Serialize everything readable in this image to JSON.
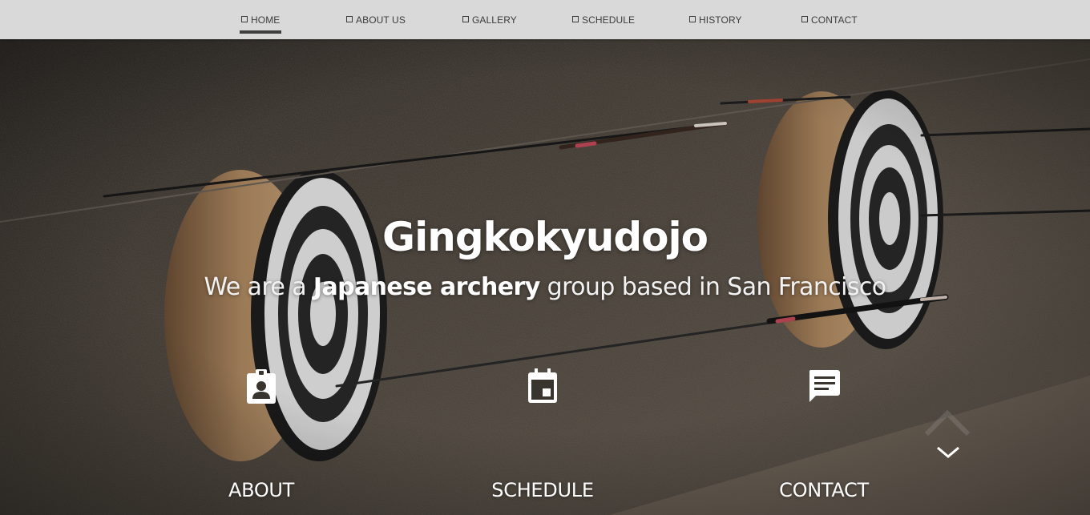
{
  "nav": {
    "items": [
      {
        "label": "HOME",
        "active": true
      },
      {
        "label": "ABOUT US",
        "active": false
      },
      {
        "label": "GALLERY",
        "active": false
      },
      {
        "label": "SCHEDULE",
        "active": false
      },
      {
        "label": "HISTORY",
        "active": false
      },
      {
        "label": "CONTACT",
        "active": false
      }
    ]
  },
  "hero": {
    "title": "Gingkokyudojo",
    "tagline_pre": "We are a ",
    "tagline_bold": "Japanese archery",
    "tagline_post": " group based in San Francisco"
  },
  "features": [
    {
      "label": "ABOUT",
      "icon": "contact-badge-icon"
    },
    {
      "label": "SCHEDULE",
      "icon": "calendar-event-icon"
    },
    {
      "label": "CONTACT",
      "icon": "chat-message-icon"
    }
  ],
  "scroll": {
    "icon": "chevron-down-icon"
  }
}
